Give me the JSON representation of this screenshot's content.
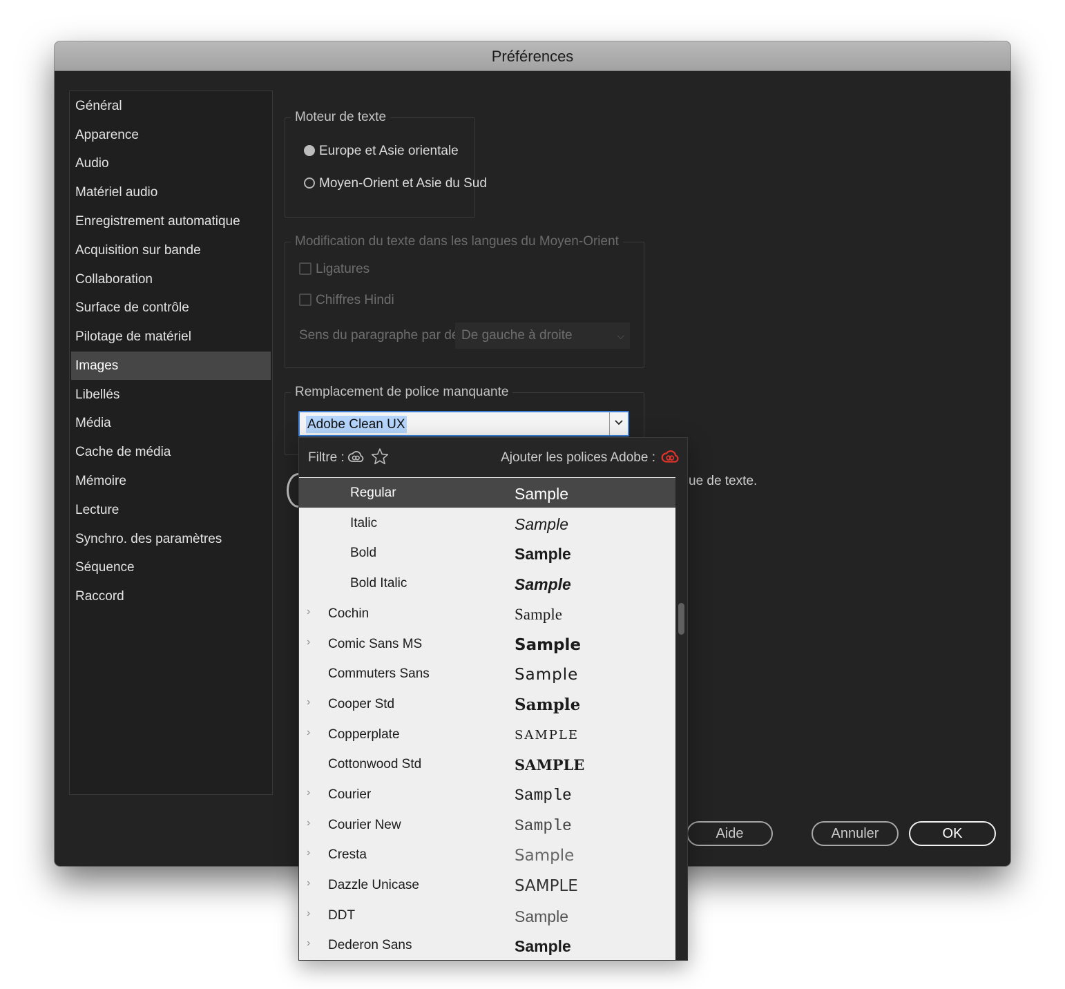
{
  "window": {
    "title": "Préférences"
  },
  "sidebar": {
    "items": [
      {
        "label": "Général"
      },
      {
        "label": "Apparence"
      },
      {
        "label": "Audio"
      },
      {
        "label": "Matériel audio"
      },
      {
        "label": "Enregistrement automatique"
      },
      {
        "label": "Acquisition sur bande"
      },
      {
        "label": "Collaboration"
      },
      {
        "label": "Surface de contrôle"
      },
      {
        "label": "Pilotage de matériel"
      },
      {
        "label": "Images"
      },
      {
        "label": "Libellés"
      },
      {
        "label": "Média"
      },
      {
        "label": "Cache de média"
      },
      {
        "label": "Mémoire"
      },
      {
        "label": "Lecture"
      },
      {
        "label": "Synchro. des paramètres"
      },
      {
        "label": "Séquence"
      },
      {
        "label": "Raccord"
      }
    ],
    "selected": "Images"
  },
  "text_engine": {
    "legend": "Moteur de texte",
    "options": [
      "Europe et Asie orientale",
      "Moyen-Orient et Asie du Sud"
    ],
    "selected": "Europe et Asie orientale"
  },
  "middle_east": {
    "legend": "Modification du texte dans les langues du Moyen-Orient",
    "ligatures": "Ligatures",
    "hindi_digits": "Chiffres Hindi",
    "paragraph_label": "Sens du paragraphe par défaut :",
    "paragraph_value": "De gauche à droite"
  },
  "missing_font": {
    "legend": "Remplacement de police manquante",
    "value": "Adobe Clean UX"
  },
  "info": {
    "text_fragment": "ue de texte."
  },
  "popup": {
    "filter_label": "Filtre :",
    "add_fonts_label": "Ajouter les polices Adobe :",
    "fonts": [
      {
        "name": "Regular",
        "sample": "Sample"
      },
      {
        "name": "Italic",
        "sample": "Sample"
      },
      {
        "name": "Bold",
        "sample": "Sample"
      },
      {
        "name": "Bold Italic",
        "sample": "Sample"
      },
      {
        "name": "Cochin",
        "sample": "Sample"
      },
      {
        "name": "Comic Sans MS",
        "sample": "Sample"
      },
      {
        "name": "Commuters Sans",
        "sample": "Sample"
      },
      {
        "name": "Cooper Std",
        "sample": "Sample"
      },
      {
        "name": "Copperplate",
        "sample": "SAMPLE"
      },
      {
        "name": "Cottonwood Std",
        "sample": "SAMPLE"
      },
      {
        "name": "Courier",
        "sample": "Sample"
      },
      {
        "name": "Courier New",
        "sample": "Sample"
      },
      {
        "name": "Cresta",
        "sample": "Sample"
      },
      {
        "name": "Dazzle Unicase",
        "sample": "SAMPLE"
      },
      {
        "name": "DDT",
        "sample": "Sample"
      },
      {
        "name": "Dederon Sans",
        "sample": "Sample"
      }
    ]
  },
  "buttons": {
    "help": "Aide",
    "cancel": "Annuler",
    "ok": "OK"
  },
  "colors": {
    "window_bg": "#232323",
    "selection": "#464646",
    "focus": "#3f7fd6",
    "adobe_red": "#e0332a"
  }
}
